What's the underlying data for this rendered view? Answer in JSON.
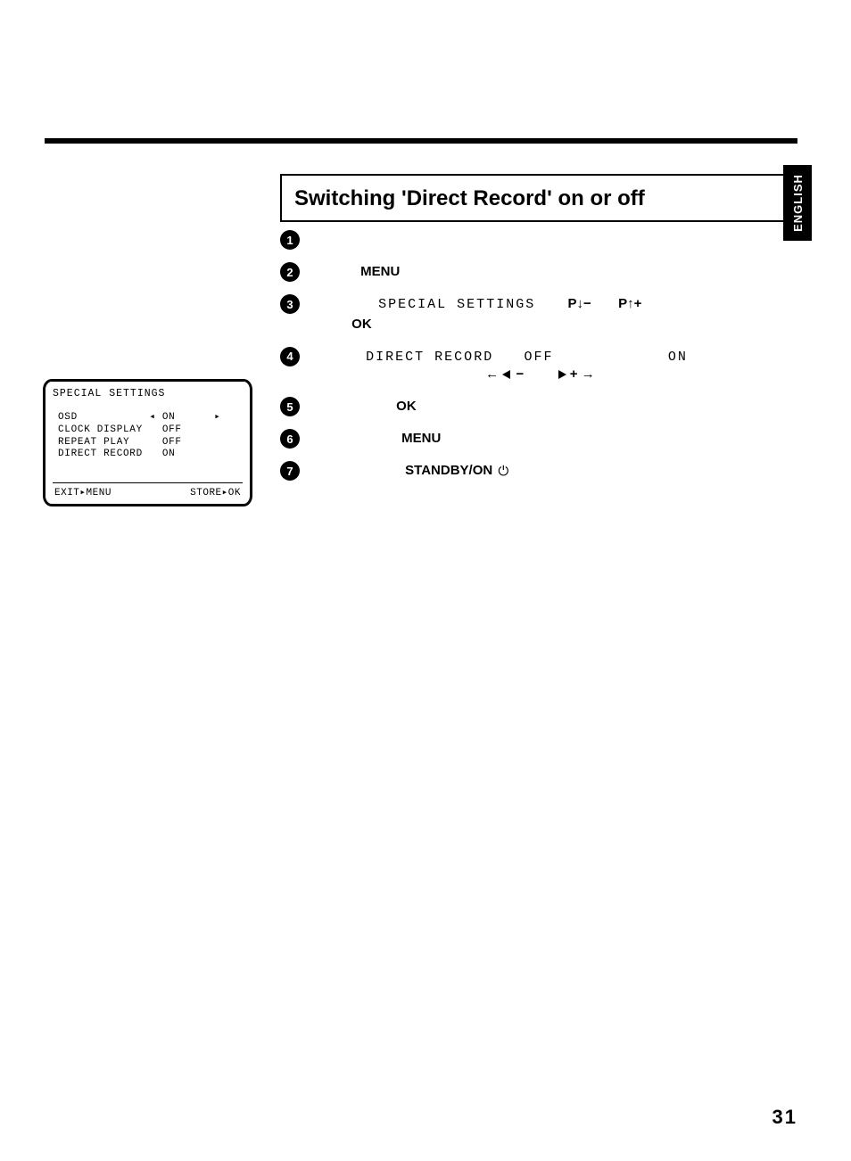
{
  "sidebar": {
    "language": "ENGLISH"
  },
  "section": {
    "title": "Switching 'Direct Record' on or off"
  },
  "steps": [
    {
      "num": "1"
    },
    {
      "num": "2",
      "menu": "MENU"
    },
    {
      "num": "3",
      "special": "SPECIAL SETTINGS",
      "pdown": "P↓−",
      "pup": "P↑+",
      "ok": "OK"
    },
    {
      "num": "4",
      "direct": "DIRECT RECORD",
      "off": "OFF",
      "on": "ON",
      "minus": "−",
      "plus": "+"
    },
    {
      "num": "5",
      "ok": "OK"
    },
    {
      "num": "6",
      "menu": "MENU"
    },
    {
      "num": "7",
      "standby": "STANDBY/ON"
    }
  ],
  "osd": {
    "title": "SPECIAL SETTINGS",
    "rows": [
      {
        "name": "OSD",
        "value": "ON"
      },
      {
        "name": "CLOCK DISPLAY",
        "value": "OFF"
      },
      {
        "name": "REPEAT PLAY",
        "value": "OFF"
      },
      {
        "name": "DIRECT RECORD",
        "value": "ON"
      }
    ],
    "footer": {
      "exit_pre": "EXIT",
      "exit_post": "MENU",
      "store_pre": "STORE",
      "store_post": "OK"
    }
  },
  "page_number": "31"
}
